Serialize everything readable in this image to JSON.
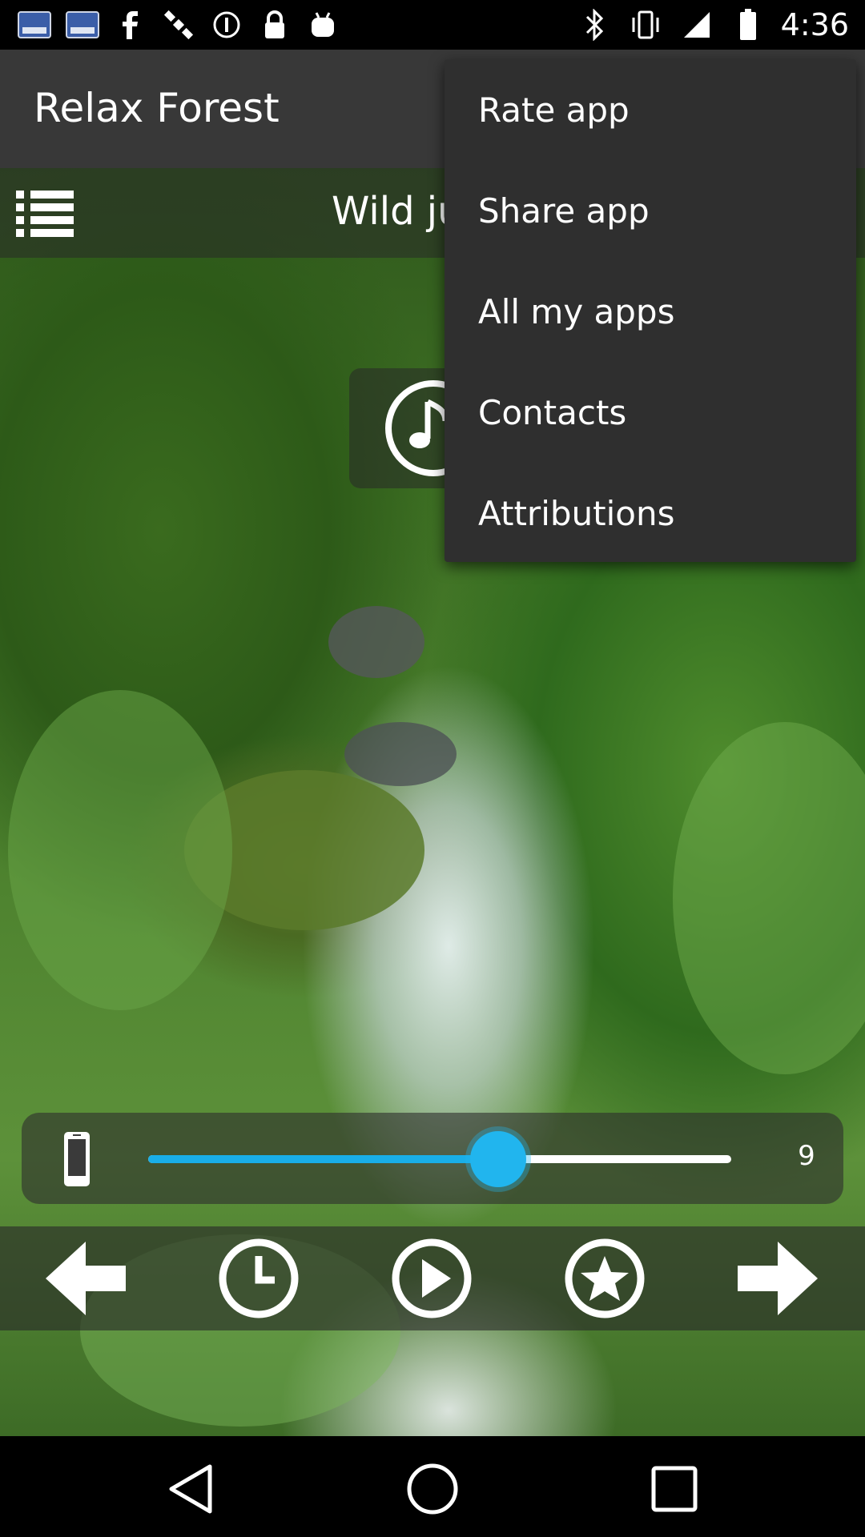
{
  "status_bar": {
    "time": "4:36",
    "left_icons": [
      "english-keyboard-icon",
      "english-keyboard-icon",
      "facebook-icon",
      "satellite-icon",
      "circle-pause-icon",
      "lock-icon",
      "android-icon"
    ],
    "right_icons": [
      "bluetooth-icon",
      "vibrate-icon",
      "signal-icon",
      "battery-icon"
    ]
  },
  "app_bar": {
    "title": "Relax Forest"
  },
  "track_bar": {
    "title": "Wild ju"
  },
  "overflow_menu": {
    "items": [
      {
        "label": "Rate app"
      },
      {
        "label": "Share app"
      },
      {
        "label": "All my apps"
      },
      {
        "label": "Contacts"
      },
      {
        "label": "Attributions"
      }
    ]
  },
  "volume": {
    "value_label": "9",
    "level_fraction": 0.6
  },
  "controls": {
    "buttons": [
      "previous",
      "timer",
      "play",
      "favorite",
      "next"
    ]
  },
  "colors": {
    "accent": "#21b5ee",
    "menu_bg": "#2f2f2f",
    "app_bar_bg": "#383838"
  }
}
